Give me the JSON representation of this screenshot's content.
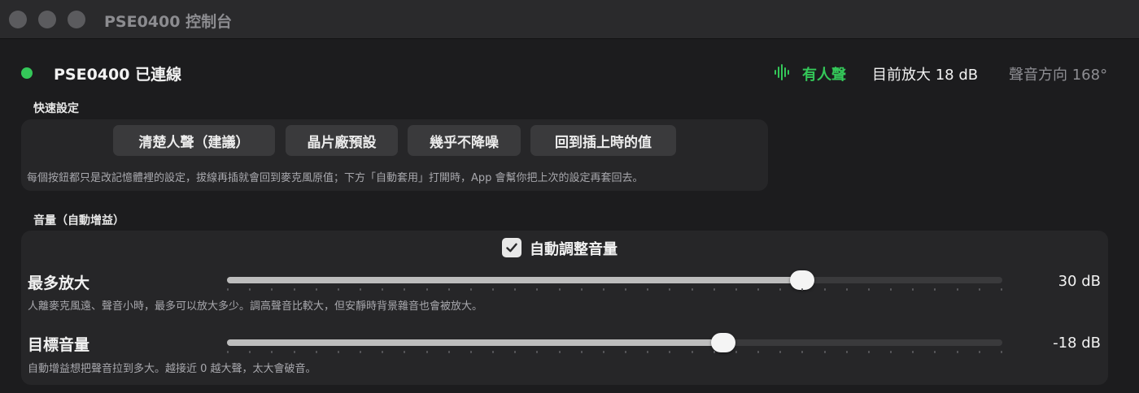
{
  "window": {
    "title": "PSE0400 控制台"
  },
  "status": {
    "device": "PSE0400 已連線",
    "voice": "有人聲",
    "gain": "目前放大 18 dB",
    "direction": "聲音方向 168°",
    "connected_color": "#34c759"
  },
  "quick": {
    "heading": "快速設定",
    "buttons": [
      "清楚人聲（建議）",
      "晶片廠預設",
      "幾乎不降噪",
      "回到插上時的值"
    ],
    "note": "每個按鈕都只是改記憶體裡的設定，拔線再插就會回到麥克風原值；下方「自動套用」打開時，App 會幫你把上次的設定再套回去。"
  },
  "volume": {
    "heading": "音量（自動增益）",
    "auto_label": "自動調整音量",
    "auto_checked": true,
    "max_gain": {
      "label": "最多放大",
      "desc": "人離麥克風遠、聲音小時，最多可以放大多少。調高聲音比較大，但安靜時背景雜音也會被放大。",
      "value_text": "30 dB",
      "fraction": 0.742
    },
    "target": {
      "label": "目標音量",
      "desc": "自動增益想把聲音拉到多大。越接近 0 越大聲，太大會破音。",
      "value_text": "-18 dB",
      "fraction": 0.64
    }
  },
  "icons": {
    "status": "status-dot-icon",
    "voice": "waveform-icon",
    "check": "checkmark-icon"
  }
}
